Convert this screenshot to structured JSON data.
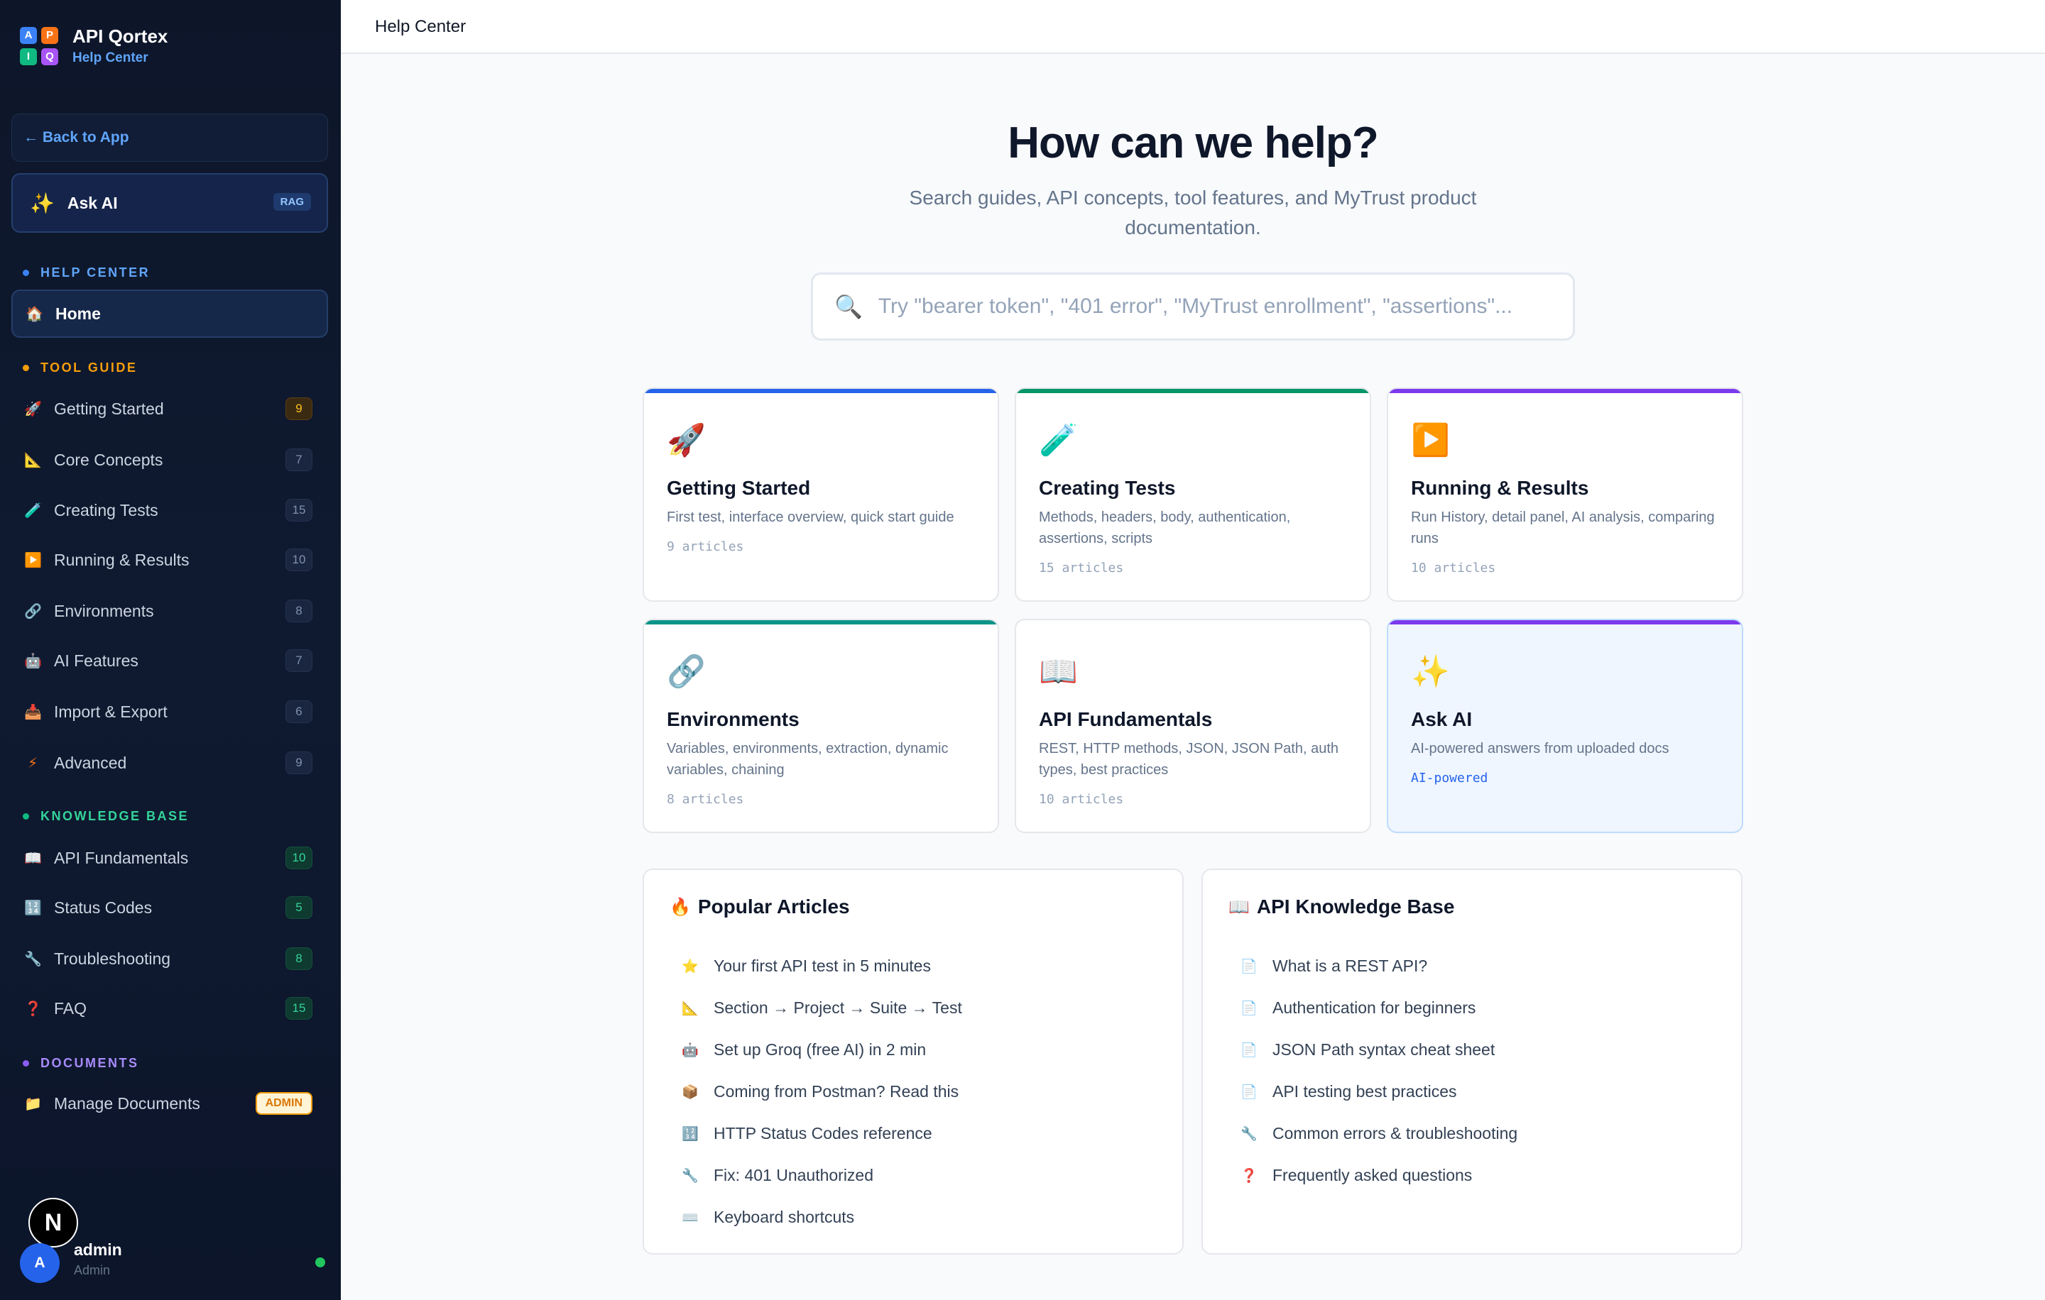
{
  "brand": {
    "title": "API Qortex",
    "subtitle": "Help Center",
    "logo_letters": [
      "A",
      "P",
      "I",
      "Q"
    ]
  },
  "sidebar": {
    "back_label": "← Back to App",
    "ask_ai": {
      "label": "Ask AI",
      "badge": "RAG"
    },
    "sections": {
      "help_center": "HELP CENTER",
      "tool_guide": "TOOL GUIDE",
      "knowledge_base": "KNOWLEDGE BASE",
      "documents": "DOCUMENTS"
    },
    "home": "Home",
    "tool_guide_items": [
      {
        "label": "Getting Started",
        "count": "9",
        "icon": "rocket-icon"
      },
      {
        "label": "Core Concepts",
        "count": "7",
        "icon": "triangle-ruler-icon"
      },
      {
        "label": "Creating Tests",
        "count": "15",
        "icon": "test-tube-icon"
      },
      {
        "label": "Running & Results",
        "count": "10",
        "icon": "play-icon"
      },
      {
        "label": "Environments",
        "count": "8",
        "icon": "link-icon"
      },
      {
        "label": "AI Features",
        "count": "7",
        "icon": "robot-icon"
      },
      {
        "label": "Import & Export",
        "count": "6",
        "icon": "inbox-tray-icon"
      },
      {
        "label": "Advanced",
        "count": "9",
        "icon": "lightning-icon"
      }
    ],
    "knowledge_items": [
      {
        "label": "API Fundamentals",
        "count": "10",
        "icon": "book-icon"
      },
      {
        "label": "Status Codes",
        "count": "5",
        "icon": "numbers-icon"
      },
      {
        "label": "Troubleshooting",
        "count": "8",
        "icon": "wrench-icon"
      },
      {
        "label": "FAQ",
        "count": "15",
        "icon": "question-icon"
      }
    ],
    "documents_item": {
      "label": "Manage Documents",
      "badge": "ADMIN",
      "icon": "folder-icon"
    },
    "user": {
      "avatar": "A",
      "name": "admin",
      "role": "Admin",
      "n_badge": "N"
    }
  },
  "header": {
    "title": "Help Center"
  },
  "hero": {
    "title": "How can we help?",
    "subtitle": "Search guides, API concepts, tool features, and MyTrust product documentation.",
    "search_placeholder": "Try \"bearer token\", \"401 error\", \"MyTrust enrollment\", \"assertions\"..."
  },
  "cards": [
    {
      "title": "Getting Started",
      "desc": "First test, interface overview, quick start guide",
      "meta": "9 articles",
      "icon": "rocket-icon",
      "accent": "#2563eb"
    },
    {
      "title": "Creating Tests",
      "desc": "Methods, headers, body, authentication, assertions, scripts",
      "meta": "15 articles",
      "icon": "test-tube-icon",
      "accent": "#059669"
    },
    {
      "title": "Running & Results",
      "desc": "Run History, detail panel, AI analysis, comparing runs",
      "meta": "10 articles",
      "icon": "play-icon",
      "accent": "#7c3aed"
    },
    {
      "title": "Environments",
      "desc": "Variables, environments, extraction, dynamic variables, chaining",
      "meta": "8 articles",
      "icon": "link-icon",
      "accent": "#0d9488"
    },
    {
      "title": "API Fundamentals",
      "desc": "REST, HTTP methods, JSON, JSON Path, auth types, best practices",
      "meta": "10 articles",
      "icon": "book-icon",
      "accent": ""
    },
    {
      "title": "Ask AI",
      "desc": "AI-powered answers from uploaded docs",
      "meta": "AI-powered",
      "icon": "sparkles-icon",
      "accent": "#7c3aed"
    }
  ],
  "popular": {
    "title": "Popular Articles",
    "items": [
      {
        "label": "Your first API test in 5 minutes",
        "icon": "star-icon"
      },
      {
        "label": "Section → Project → Suite → Test",
        "icon": "triangle-ruler-icon"
      },
      {
        "label": "Set up Groq (free AI) in 2 min",
        "icon": "robot-icon"
      },
      {
        "label": "Coming from Postman? Read this",
        "icon": "package-icon"
      },
      {
        "label": "HTTP Status Codes reference",
        "icon": "numbers-icon"
      },
      {
        "label": "Fix: 401 Unauthorized",
        "icon": "wrench-icon"
      },
      {
        "label": "Keyboard shortcuts",
        "icon": "keyboard-icon"
      }
    ]
  },
  "knowledge": {
    "title": "API Knowledge Base",
    "items": [
      {
        "label": "What is a REST API?",
        "icon": "page-icon"
      },
      {
        "label": "Authentication for beginners",
        "icon": "page-icon"
      },
      {
        "label": "JSON Path syntax cheat sheet",
        "icon": "page-icon"
      },
      {
        "label": "API testing best practices",
        "icon": "page-icon"
      },
      {
        "label": "Common errors & troubleshooting",
        "icon": "wrench-icon"
      },
      {
        "label": "Frequently asked questions",
        "icon": "question-icon"
      }
    ]
  },
  "colors": {
    "sidebar_bg": "#0d1629",
    "accent_blue": "#2563eb",
    "accent_green": "#059669",
    "accent_purple": "#7c3aed",
    "accent_teal": "#0d9488",
    "admin_badge": "#f59e0b"
  }
}
